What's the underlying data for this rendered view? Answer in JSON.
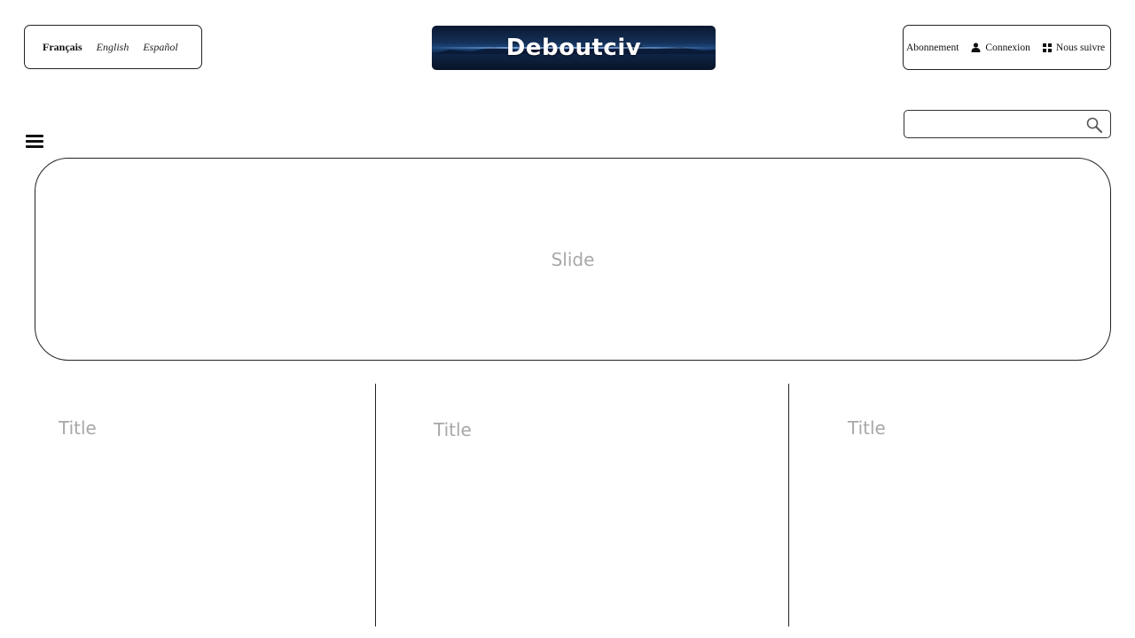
{
  "languages": {
    "active": "Français",
    "others": [
      "English",
      "Español"
    ]
  },
  "logo": {
    "text": "Deboutciv"
  },
  "account": {
    "subscribe": "Abonnement",
    "login": "Connexion",
    "follow": "Nous suivre"
  },
  "search": {
    "placeholder": "",
    "value": ""
  },
  "slide": {
    "label": "Slide"
  },
  "columns": [
    {
      "title": "Title"
    },
    {
      "title": "Title"
    },
    {
      "title": "Title"
    }
  ],
  "colors": {
    "border": "#222222",
    "placeholder_text": "#a8a8a8",
    "logo_bg": "#143058"
  }
}
